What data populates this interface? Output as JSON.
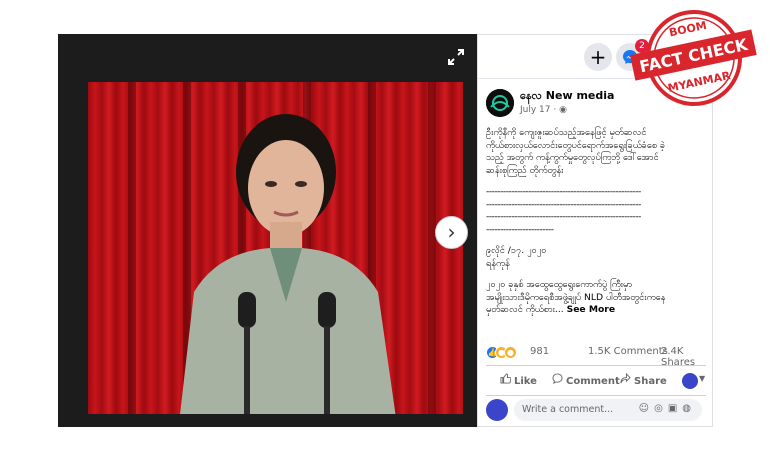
{
  "viewer": {
    "expand_icon": "expand-icon",
    "next_icon": "chevron-right-icon",
    "next_glyph": "›"
  },
  "topbar": {
    "add_glyph": "+",
    "messenger_badge": "2",
    "icons": [
      "plus-icon",
      "messenger-icon",
      "notification-icon"
    ]
  },
  "post": {
    "page_name": "နေလ New media",
    "date": "July 17 · ",
    "body": [
      "ဦးကိုနီကို ကျေးဇူးဆပ်သည့်အနေဖြင့် မှတ်ဆလင်",
      "ကိုယ်စားလှယ်လောင်းတွေ​ပင်ရောက်အရွေးခြယ်ခံစေ ခဲ့",
      "သည့် အတွက် ကန့်ကွက်မှုတွေ​လုပ်ကြဘို့ ဒေါ်အောင်",
      "ဆန်းစုကြည် တိုက်တွန်း"
    ],
    "dash_lines": [
      "-------------------------------------------------------",
      "-------------------------------------------------------",
      "-------------------------------------------------------",
      "------------------------"
    ],
    "dateline": [
      "၉လိုင် /၁၇. ၂၀၂၀",
      "ရန်ကုန်"
    ],
    "body2": [
      "၂၀၂၀ ခုနှစ် အထွေထွေရွေးကောက်ပွဲ ကြီးမှာ",
      "အမျိုးသားဒီမိုကရေစီအဖွဲ့ချုပ် NLD ပါတီအတွင်းကနေ",
      "မှတ်ဆလင် ကိုယ်စား..."
    ],
    "see_more": "See More",
    "reaction_count": "981",
    "comments": "1.5K Comments",
    "shares": "2.4K Shares",
    "like_label": "Like",
    "comment_label": "Comment",
    "share_label": "Share",
    "comment_placeholder": "Write a comment...",
    "reaction_icons": [
      "like-icon",
      "haha-icon",
      "wow-icon"
    ]
  },
  "stamp": {
    "top": "BOOM",
    "main": "FACT CHECK",
    "bottom": "MYANMAR"
  },
  "colors": {
    "accent": "#1877f2",
    "stamp_red": "#d8262c",
    "badge_red": "#e41e3f"
  }
}
